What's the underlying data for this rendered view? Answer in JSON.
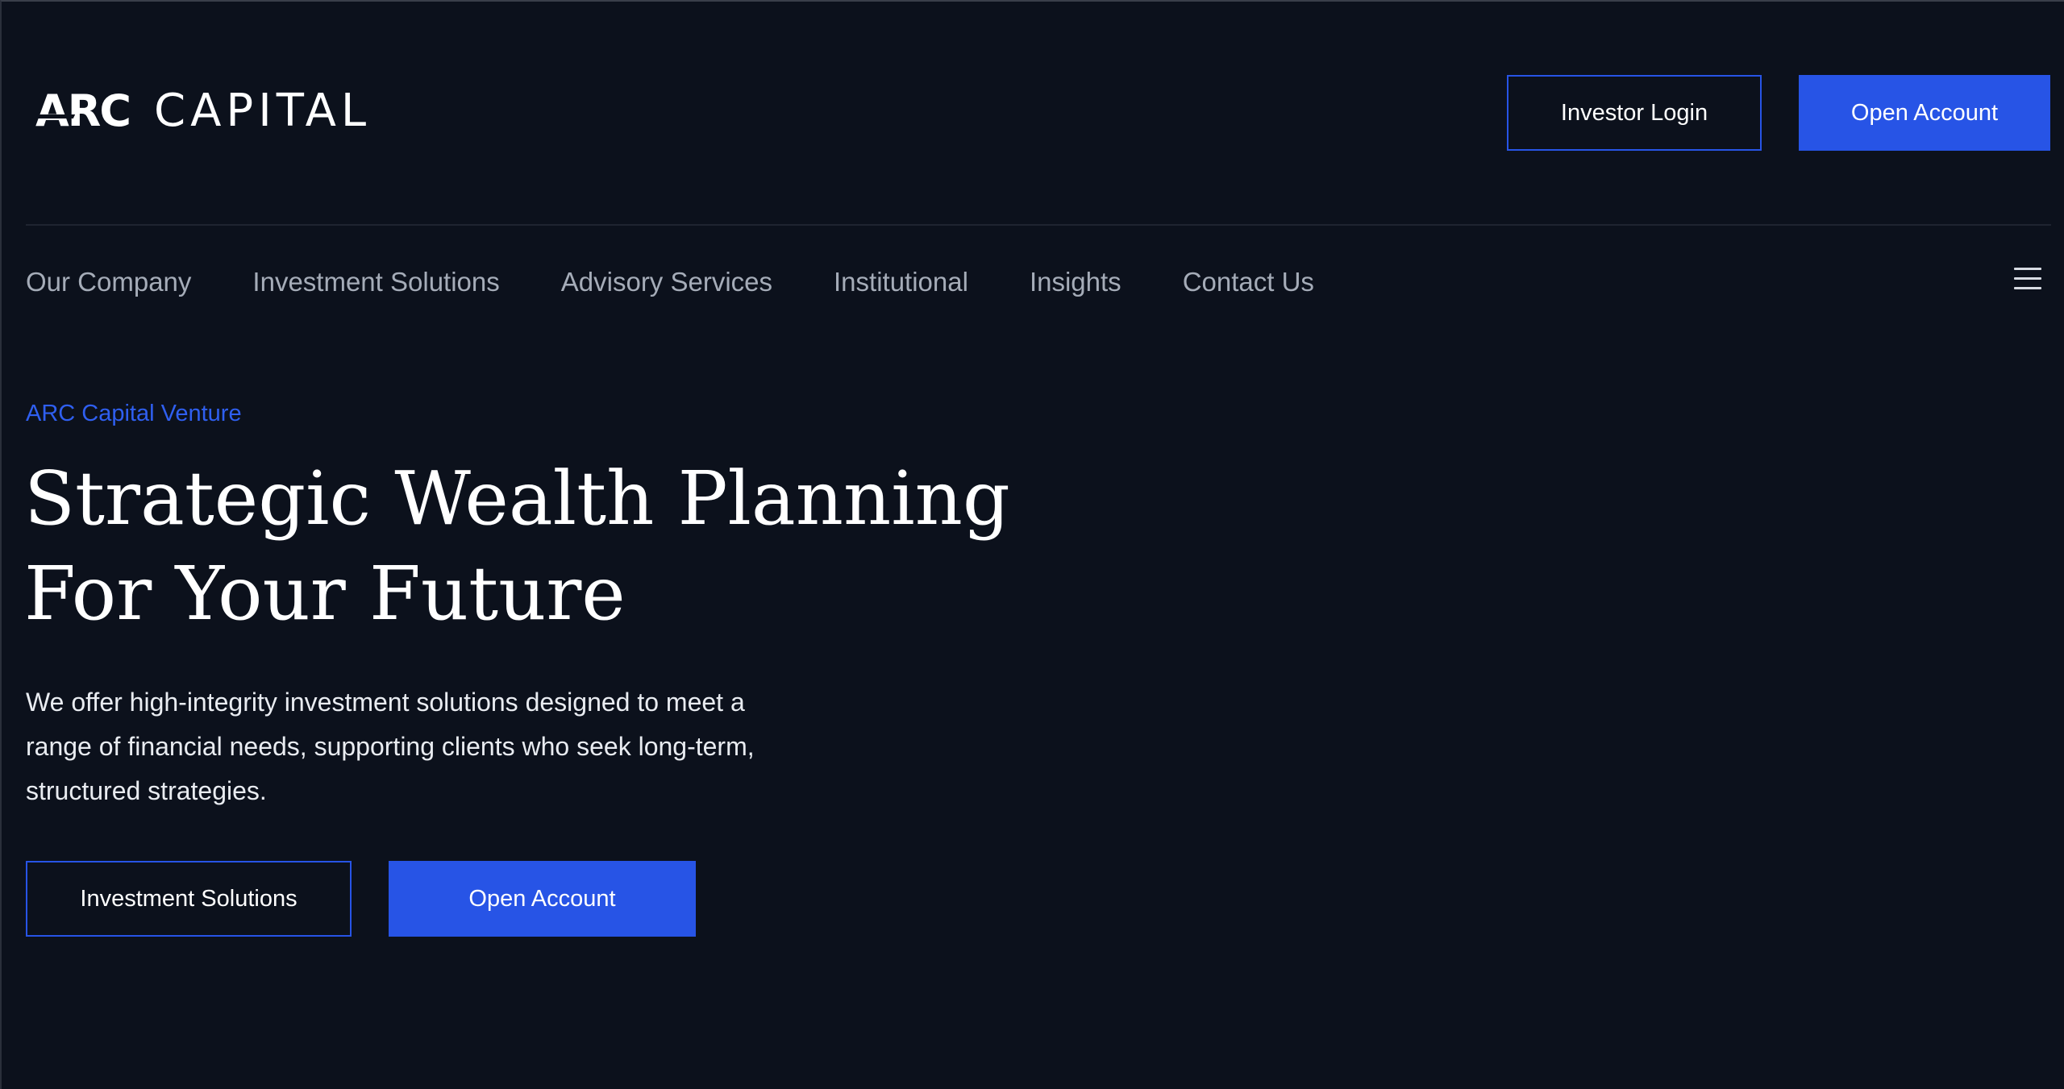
{
  "brand": {
    "mark": "ARC",
    "word": "CAPITAL"
  },
  "header": {
    "investor_login_label": "Investor Login",
    "open_account_label": "Open Account"
  },
  "nav": {
    "items": [
      {
        "label": "Our Company"
      },
      {
        "label": "Investment Solutions"
      },
      {
        "label": "Advisory Services"
      },
      {
        "label": "Institutional"
      },
      {
        "label": "Insights"
      },
      {
        "label": "Contact Us"
      }
    ],
    "menu_icon": "hamburger-menu-icon"
  },
  "hero": {
    "eyebrow": "ARC Capital Venture",
    "title_lines": [
      "Strategic Wealth Planning",
      "For Your Future"
    ],
    "description_lines": [
      "We offer high-integrity investment solutions designed to meet a",
      "range of financial needs, supporting clients who seek long-term,",
      "structured strategies."
    ],
    "primary_cta_label": "Investment Solutions",
    "secondary_cta_label": "Open Account"
  },
  "colors": {
    "background": "#0c111c",
    "accent": "#2754e6",
    "nav_text": "#a5acb8",
    "eyebrow": "#2f5ff0"
  }
}
